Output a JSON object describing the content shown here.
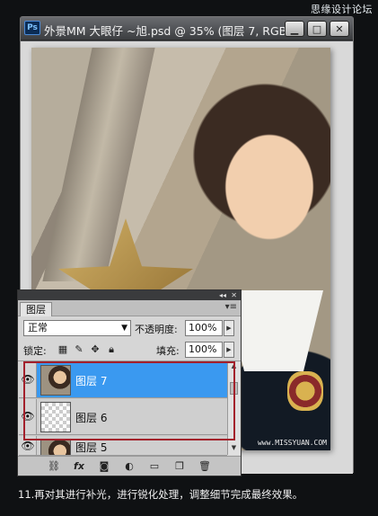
{
  "watermark_top": "思缘设计论坛",
  "watermark_bottom": "www.MISSYUAN.COM",
  "window": {
    "app_icon": "Ps",
    "title": "外景MM 大眼仔 ~旭.psd @ 35% (图层 7, RGB...",
    "buttons": {
      "minimize": "▁",
      "maximize": "□",
      "close": "✕"
    }
  },
  "layers_panel": {
    "tab": "图层",
    "blend_mode": "正常",
    "opacity_label": "不透明度:",
    "opacity_value": "100%",
    "lock_label": "锁定:",
    "fill_label": "填充:",
    "fill_value": "100%",
    "layers": [
      {
        "name": "图层 7",
        "selected": true,
        "visible": true
      },
      {
        "name": "图层 6",
        "selected": false,
        "visible": true
      },
      {
        "name": "图层 5",
        "selected": false,
        "visible": true
      }
    ],
    "toolbar_icons": [
      "link-icon",
      "fx-icon",
      "mask-icon",
      "adjustment-icon",
      "group-icon",
      "new-layer-icon",
      "trash-icon"
    ]
  },
  "caption": "11.再对其进行补光，进行锐化处理，调整细节完成最终效果。"
}
